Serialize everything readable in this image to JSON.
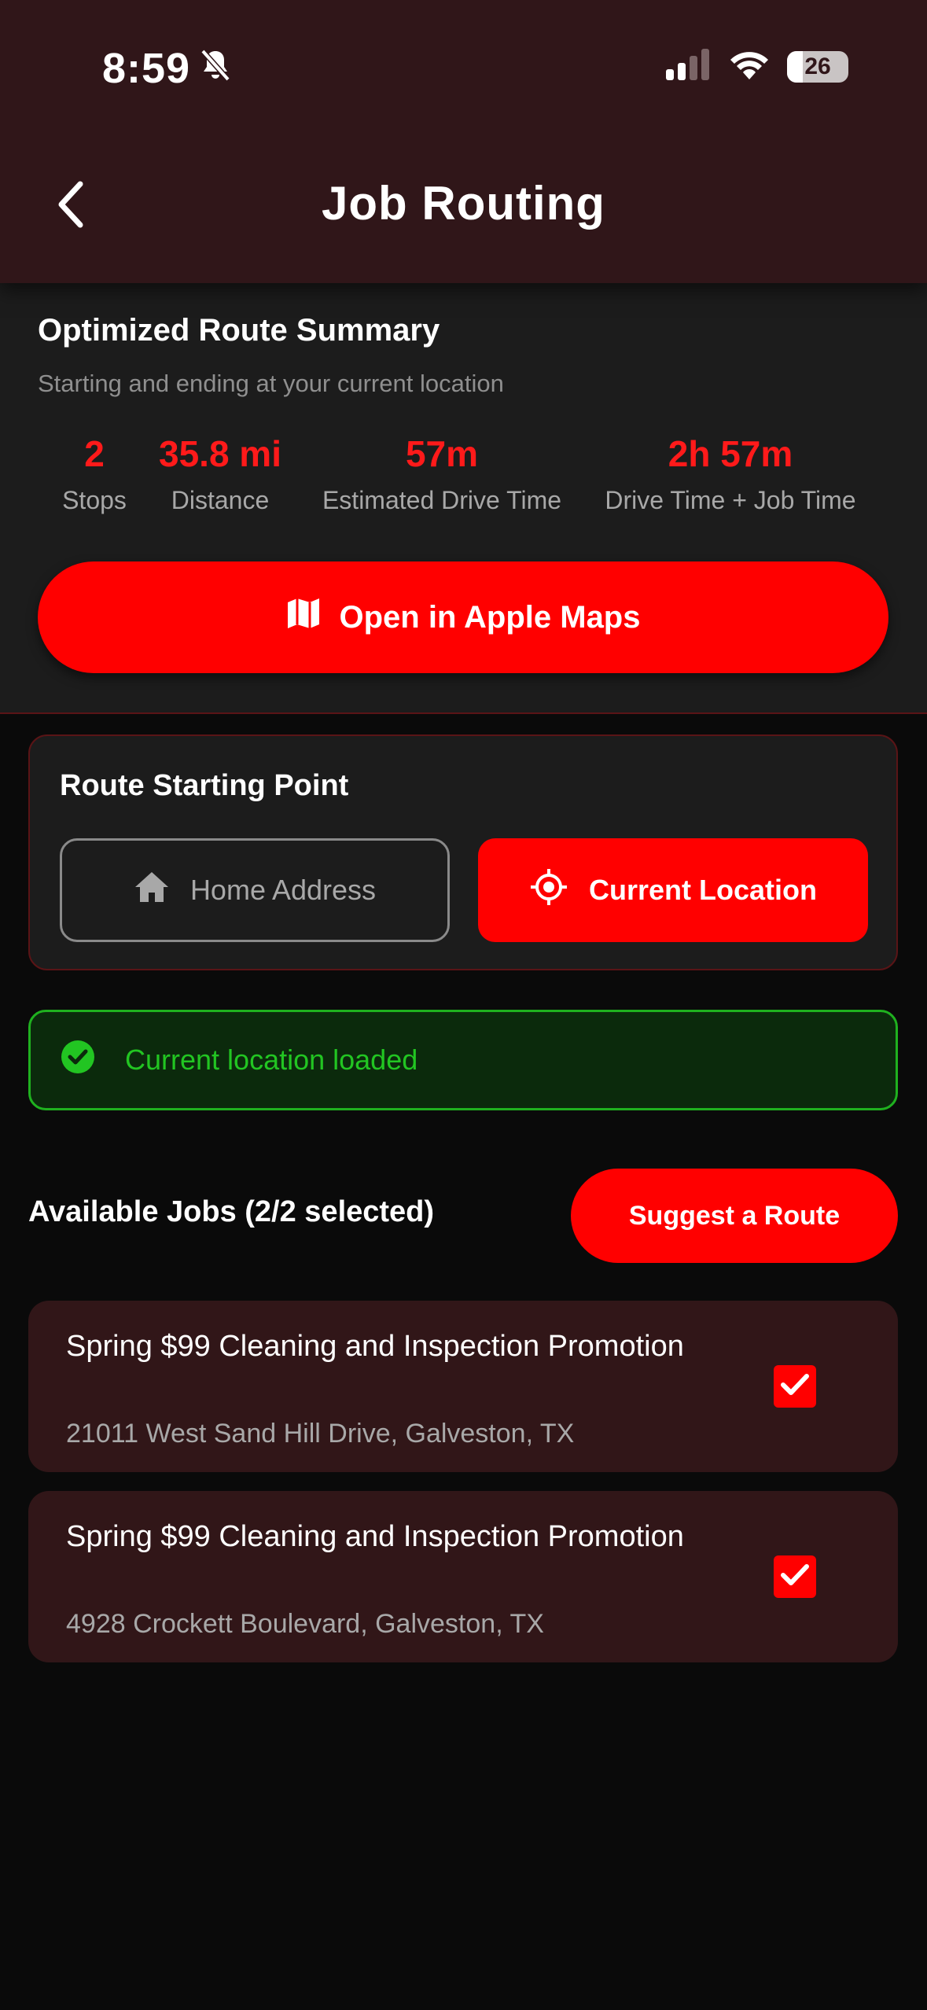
{
  "status_bar": {
    "time": "8:59",
    "battery": "26",
    "icons": [
      "bell-slash-icon",
      "cellular-signal-icon",
      "wifi-icon",
      "battery-icon"
    ]
  },
  "header": {
    "title": "Job Routing",
    "back_icon": "chevron-left-icon"
  },
  "summary": {
    "title": "Optimized Route Summary",
    "subtitle": "Starting and ending at your current location",
    "stats": [
      {
        "value": "2",
        "label": "Stops"
      },
      {
        "value": "35.8 mi",
        "label": "Distance"
      },
      {
        "value": "57m",
        "label": "Estimated Drive Time"
      },
      {
        "value": "2h 57m",
        "label": "Drive Time + Job Time"
      }
    ],
    "maps_button": "Open in Apple Maps"
  },
  "starting_point": {
    "title": "Route Starting Point",
    "options": [
      {
        "label": "Home Address",
        "icon": "home-icon",
        "selected": false
      },
      {
        "label": "Current Location",
        "icon": "crosshair-icon",
        "selected": true
      }
    ]
  },
  "location_status": {
    "text": "Current location loaded",
    "icon": "check-circle-icon"
  },
  "jobs": {
    "header": "Available Jobs (2/2 selected)",
    "suggest_button": "Suggest a Route",
    "items": [
      {
        "title": "Spring $99 Cleaning and Inspection Promotion",
        "address": "21011 West Sand Hill Drive, Galveston, TX",
        "checked": true
      },
      {
        "title": "Spring $99 Cleaning and Inspection Promotion",
        "address": "4928 Crockett Boulevard, Galveston, TX",
        "checked": true
      }
    ]
  },
  "colors": {
    "accent": "#ff0000",
    "header_bg": "#301619",
    "card_bg": "#1c1c1c",
    "success": "#22c522"
  }
}
